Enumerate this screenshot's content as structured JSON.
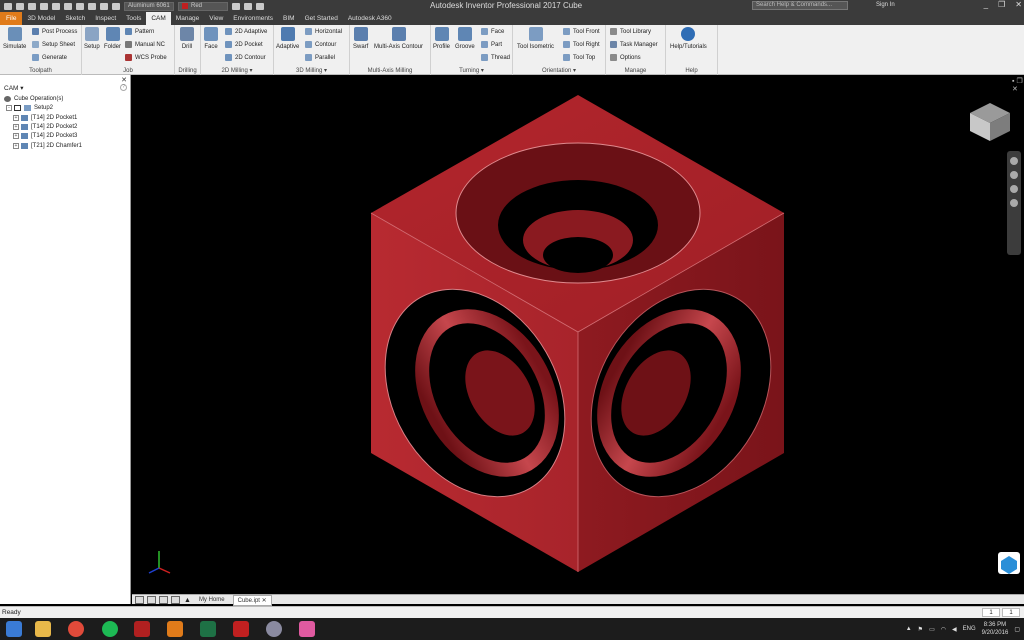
{
  "app": {
    "title": "Autodesk Inventor Professional 2017   Cube"
  },
  "qat": {
    "material": "Aluminum 6061",
    "appearance": "Red"
  },
  "search": {
    "placeholder": "Search Help & Commands..."
  },
  "account": {
    "signin": "Sign In"
  },
  "tabs": [
    "File",
    "3D Model",
    "Sketch",
    "Inspect",
    "Tools",
    "CAM",
    "Manage",
    "View",
    "Environments",
    "BIM",
    "Get Started",
    "Autodesk A360"
  ],
  "ribbon": {
    "toolpath": {
      "title": "Toolpath",
      "simulate": "Simulate",
      "post_process": "Post Process",
      "setup_sheet": "Setup Sheet",
      "generate": "Generate"
    },
    "job": {
      "title": "Job",
      "setup": "Setup",
      "folder": "Folder",
      "pattern": "Pattern",
      "manual_nc": "Manual NC",
      "wcs_probe": "WCS Probe"
    },
    "drilling": {
      "title": "Drilling",
      "drill": "Drill"
    },
    "milling2d": {
      "title": "2D Milling",
      "face": "Face",
      "adaptive": "2D Adaptive",
      "pocket": "2D Pocket",
      "contour": "2D Contour"
    },
    "milling3d": {
      "title": "3D Milling",
      "adaptive": "Adaptive",
      "horizontal": "Horizontal",
      "contour": "Contour",
      "parallel": "Parallel"
    },
    "multiaxis": {
      "title": "Multi-Axis Milling",
      "swarf": "Swarf",
      "multi_contour": "Multi-Axis Contour"
    },
    "turning": {
      "title": "Turning",
      "profile": "Profile",
      "groove": "Groove",
      "face": "Face",
      "part": "Part",
      "thread": "Thread"
    },
    "orientation": {
      "title": "Orientation",
      "tool_isometric": "Tool Isometric",
      "tool_front": "Tool Front",
      "tool_right": "Tool Right",
      "tool_top": "Tool Top"
    },
    "manage": {
      "title": "Manage",
      "tool_library": "Tool Library",
      "task_manager": "Task Manager",
      "options": "Options"
    },
    "help": {
      "title": "Help",
      "help_tutorials": "Help/Tutorials"
    }
  },
  "browser": {
    "header": "CAM",
    "items": [
      "Cube Operation(s)",
      "Setup2",
      "[T14] 2D Pocket1",
      "[T14] 2D Pocket2",
      "[T14] 2D Pocket3",
      "[T21] 2D Chamfer1"
    ]
  },
  "doc_tabs": [
    "My Home",
    "Cube.ipt"
  ],
  "status": {
    "text": "Ready",
    "cell1": "1",
    "cell2": "1"
  },
  "tray": {
    "lang": "ENG",
    "time": "8:36 PM",
    "date": "9/20/2016"
  },
  "colors": {
    "ribbon_bg": "#f0f0f0",
    "title_bg": "#3b3b3b",
    "file_tab": "#e07b1a",
    "cube_red": "#b1272e",
    "viewport_bg": "#000000"
  }
}
